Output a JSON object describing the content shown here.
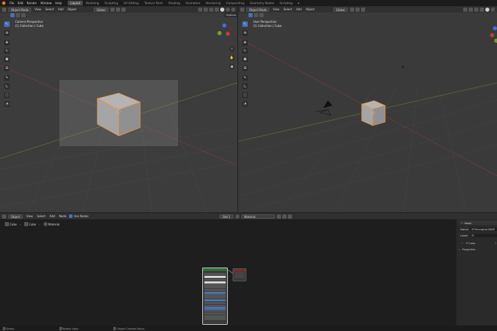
{
  "topbar": {
    "menus": [
      "File",
      "Edit",
      "Render",
      "Window",
      "Help"
    ],
    "workspaces": [
      "Layout",
      "Modeling",
      "Sculpting",
      "UV Editing",
      "Texture Paint",
      "Shading",
      "Animation",
      "Rendering",
      "Compositing",
      "Geometry Nodes",
      "Scripting"
    ],
    "active_workspace": "Layout"
  },
  "viewport_left": {
    "mode": "Object Mode",
    "menus": [
      "View",
      "Select",
      "Add",
      "Object"
    ],
    "transform": "Global",
    "options": "Options",
    "title": "Camera Perspective",
    "subtitle": "(1) Collection | Cube"
  },
  "viewport_right": {
    "mode": "Object Mode",
    "menus": [
      "View",
      "Select",
      "Add",
      "Object"
    ],
    "transform": "Global",
    "title": "User Perspective",
    "subtitle": "(1) Collection | Cube"
  },
  "node_editor": {
    "editor": "Object",
    "menus": [
      "View",
      "Select",
      "Add",
      "Node"
    ],
    "use_nodes_label": "Use Nodes",
    "slot": "Slot 1",
    "material": "Material",
    "breadcrumb": [
      "Cube",
      "Cube",
      "Material"
    ]
  },
  "properties": {
    "tab": "Node",
    "name_label": "Name:",
    "name_value": "Principled BSDF",
    "label_label": "Label:",
    "color_section": "Color",
    "properties_section": "Properties"
  },
  "status": {
    "items": [
      "Select",
      "Rotate View",
      "Object Context Menu"
    ]
  },
  "colors": {
    "accent": "#4772b3",
    "selection": "#e8963a",
    "x_axis": "#c03c3c",
    "y_axis": "#7c9a2e",
    "z_axis": "#3f6fd0"
  }
}
